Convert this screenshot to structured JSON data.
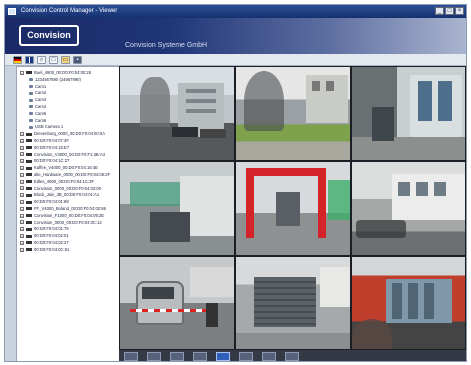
{
  "window": {
    "title": "Convision Control Manager - Viewer"
  },
  "banner": {
    "logo_text": "Convision",
    "company": "Convision Systeme GmbH"
  },
  "toolbar": {
    "icons": [
      "flag-de-icon",
      "flag-en-icon",
      "search-icon",
      "new-icon",
      "open-icon",
      "save-icon"
    ]
  },
  "tree": {
    "items": [
      {
        "label": "Buel_4900_00:D0:F0:04:00:26",
        "level": 0,
        "kind": "device"
      },
      {
        "label": "1234567890 (24667990)",
        "level": 1,
        "kind": "camera"
      },
      {
        "label": "Cam1",
        "level": 1,
        "kind": "camera"
      },
      {
        "label": "Cam2",
        "level": 1,
        "kind": "camera"
      },
      {
        "label": "Cam3",
        "level": 1,
        "kind": "camera"
      },
      {
        "label": "Cam4",
        "level": 1,
        "kind": "camera"
      },
      {
        "label": "Cam5",
        "level": 1,
        "kind": "camera"
      },
      {
        "label": "Cam6",
        "level": 1,
        "kind": "camera"
      },
      {
        "label": "USB Camera 1",
        "level": 1,
        "kind": "camera"
      },
      {
        "label": "Drevenburg_0000_00:D0:F0:04:00:0A",
        "level": 0,
        "kind": "device"
      },
      {
        "label": "00:D0:F0:04:07:4F",
        "level": 0,
        "kind": "device"
      },
      {
        "label": "00:D0:F0:04:15:E7",
        "level": 0,
        "kind": "device"
      },
      {
        "label": "Convision_V4000_00:D0:F0:F1:3B:A4",
        "level": 0,
        "kind": "device"
      },
      {
        "label": "00:D0:F0:04:1C:27",
        "level": 0,
        "kind": "device"
      },
      {
        "label": "Kaffee_V4000_00:D0:F0:04:16:4E",
        "level": 0,
        "kind": "device"
      },
      {
        "label": "alte_Hardware_0000_00:D0:F0:04:06:2F",
        "level": 0,
        "kind": "device"
      },
      {
        "label": "Edles_4900_00:D0:F0:04:1C:3F",
        "level": 0,
        "kind": "device"
      },
      {
        "label": "Convision_0000_00:D0:F0:04:03:00",
        "level": 0,
        "kind": "device"
      },
      {
        "label": "Block_Jain_3B_00:D0:F0:04:01:A1",
        "level": 0,
        "kind": "device"
      },
      {
        "label": "00:D0:F0:04:01:88",
        "level": 0,
        "kind": "device"
      },
      {
        "label": "FF_V4000_Boland_00:D0:F0:04:02:86",
        "level": 0,
        "kind": "device"
      },
      {
        "label": "Convision_F1000_00:D0:F0:04:09:2E",
        "level": 0,
        "kind": "device"
      },
      {
        "label": "Convision_0000_00:D0:F0:04:0C:12",
        "level": 0,
        "kind": "device"
      },
      {
        "label": "00:D0:F0:04:01:75",
        "level": 0,
        "kind": "device"
      },
      {
        "label": "00:D0:F0:04:02:01",
        "level": 0,
        "kind": "device"
      },
      {
        "label": "00:D0:F0:04:02:27",
        "level": 0,
        "kind": "device"
      },
      {
        "label": "00:D0:F0:04:0C:61",
        "level": 0,
        "kind": "device"
      }
    ]
  },
  "video_grid": {
    "tiles": [
      "street-buildings-view",
      "trees-plaza-view",
      "building-entrance-view",
      "garage-ramp-view",
      "red-gate-view",
      "parked-bicycles-view",
      "parking-barrier-car-view",
      "garage-door-view",
      "red-facade-view"
    ]
  },
  "layout_buttons": {
    "count": 8,
    "active_index": 4
  },
  "colors": {
    "banner_dark": "#1b2a66",
    "accent_blue": "#2f5fb8",
    "tree_bg": "#ffffff",
    "frame": "#c9d3df"
  }
}
